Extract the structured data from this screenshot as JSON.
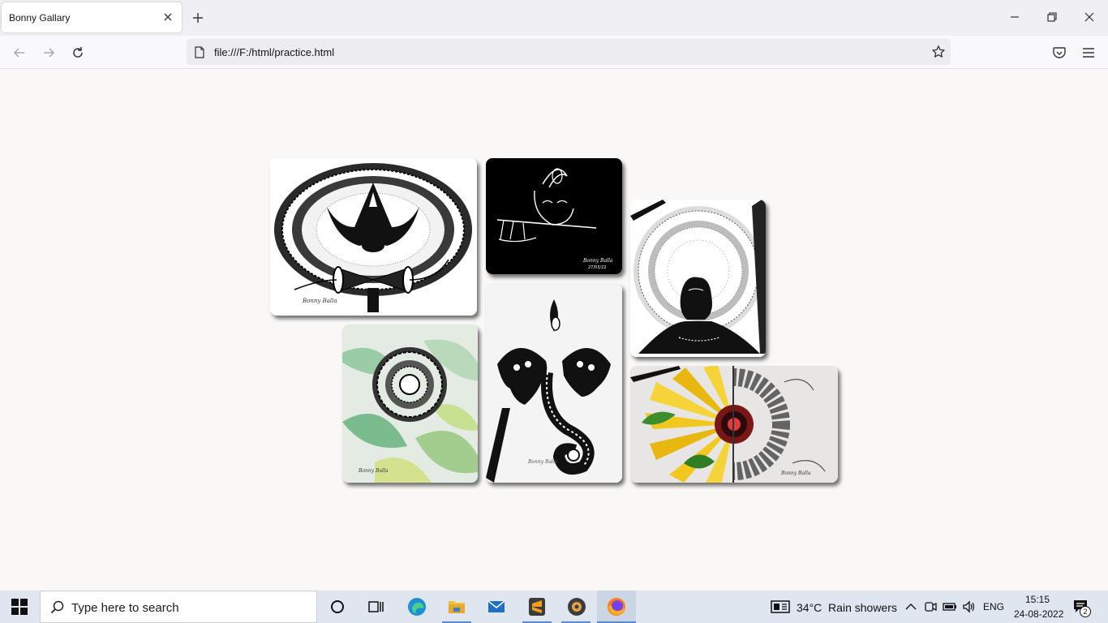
{
  "browser": {
    "tab_title": "Bonny Gallary",
    "url": "file:///F:/html/practice.html"
  },
  "gallery": {
    "items": [
      {
        "name": "trishul-damru-mandala",
        "background": "#ffffff"
      },
      {
        "name": "krishna-flute-sketch",
        "background": "#000000"
      },
      {
        "name": "shiva-mandala",
        "background": "#ffffff"
      },
      {
        "name": "leaf-print-mandala",
        "background": "#dfe8dd"
      },
      {
        "name": "ganesha-mandala",
        "background": "#ffffff"
      },
      {
        "name": "sunflower-mandala",
        "background": "#e8e6e4"
      }
    ]
  },
  "taskbar": {
    "search_placeholder": "Type here to search",
    "weather": "34°C  Rain showers",
    "language": "ENG",
    "time": "15:15",
    "date": "24-08-2022",
    "notification_count": "2"
  }
}
